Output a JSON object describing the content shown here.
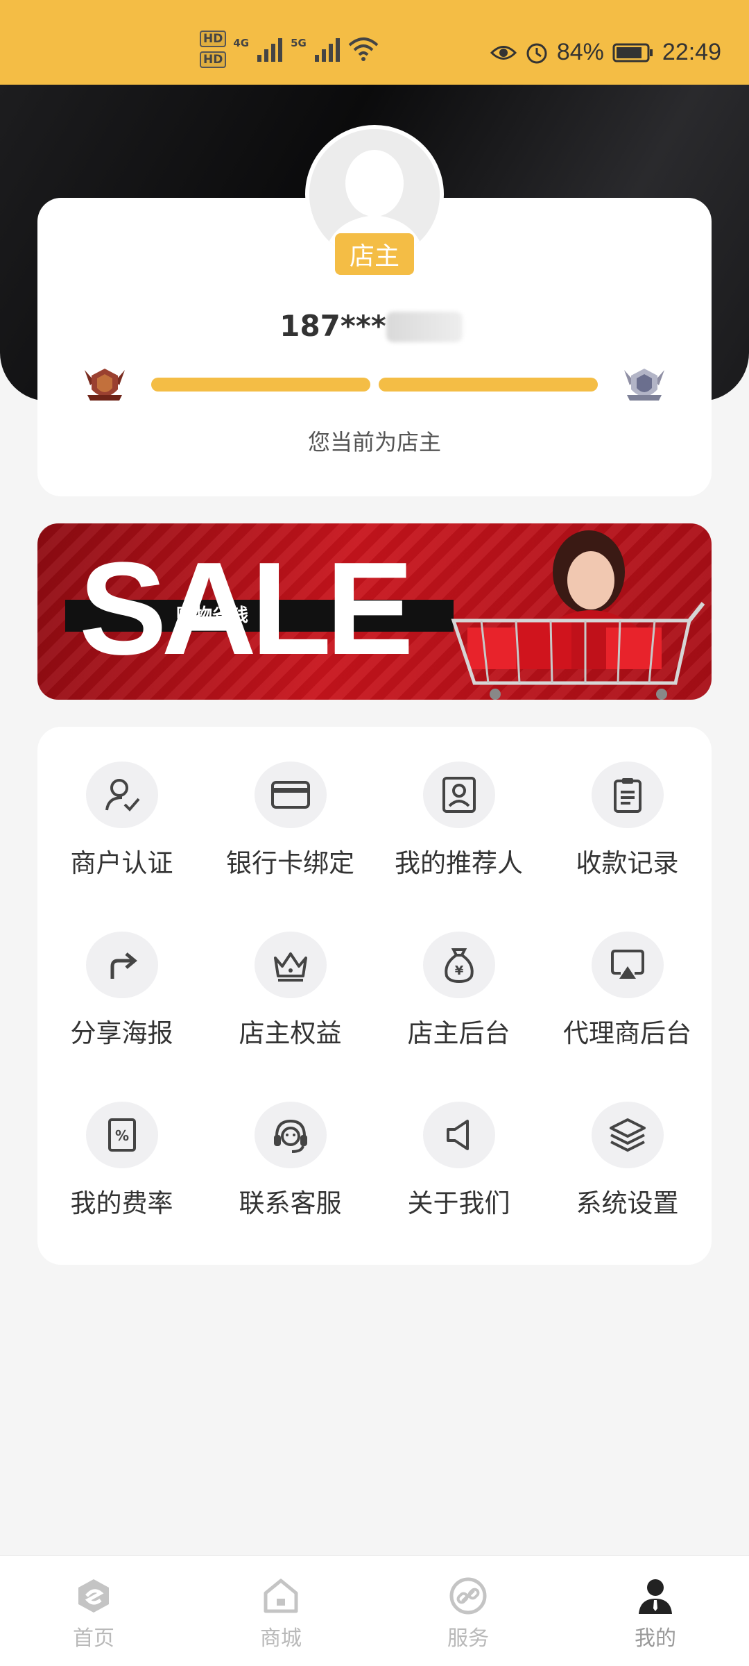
{
  "status_bar": {
    "hd1": "HD",
    "hd2": "HD",
    "net1": "4G",
    "net2": "5G",
    "battery": "84%",
    "time": "22:49"
  },
  "profile": {
    "role_badge": "店主",
    "phone": "187***",
    "current_level_text": "您当前为店主"
  },
  "banner": {
    "title": "SALE",
    "subtitle": "购物省钱"
  },
  "menu": [
    {
      "label": "商户认证",
      "icon": "user-check-icon"
    },
    {
      "label": "银行卡绑定",
      "icon": "bank-card-icon"
    },
    {
      "label": "我的推荐人",
      "icon": "referrer-icon"
    },
    {
      "label": "收款记录",
      "icon": "clipboard-icon"
    },
    {
      "label": "分享海报",
      "icon": "share-arrow-icon"
    },
    {
      "label": "店主权益",
      "icon": "crown-icon"
    },
    {
      "label": "店主后台",
      "icon": "money-bag-icon"
    },
    {
      "label": "代理商后台",
      "icon": "airplay-icon"
    },
    {
      "label": "我的费率",
      "icon": "percent-doc-icon"
    },
    {
      "label": "联系客服",
      "icon": "headset-icon"
    },
    {
      "label": "关于我们",
      "icon": "speaker-icon"
    },
    {
      "label": "系统设置",
      "icon": "layers-icon"
    }
  ],
  "nav": [
    {
      "label": "首页",
      "icon": "home-logo-icon"
    },
    {
      "label": "商城",
      "icon": "store-icon"
    },
    {
      "label": "服务",
      "icon": "link-icon"
    },
    {
      "label": "我的",
      "icon": "person-icon"
    }
  ],
  "colors": {
    "accent": "#f4bd45",
    "header_dark": "#111111",
    "banner_red": "#c8141c"
  }
}
